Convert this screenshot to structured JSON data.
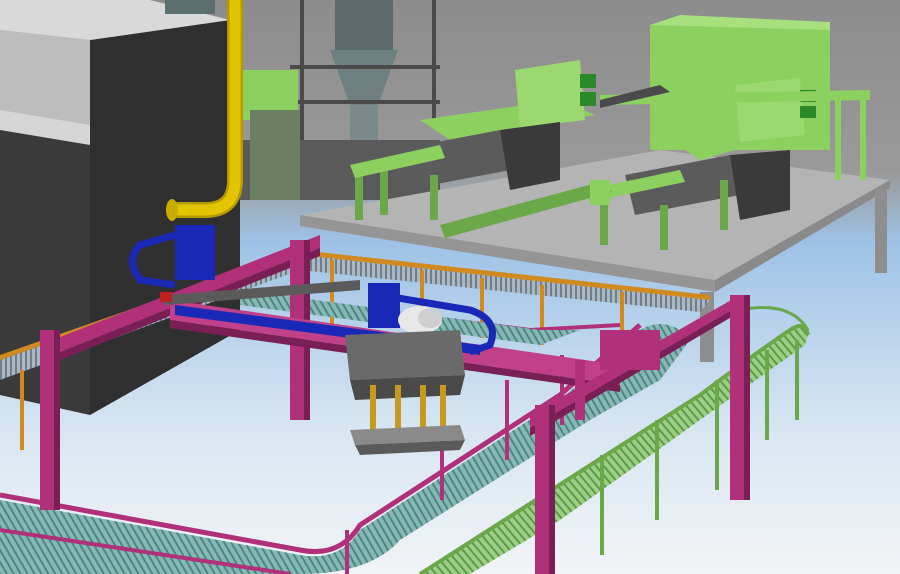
{
  "scene": {
    "colors": {
      "sky_top": "#8c8c8c",
      "sky_blue": "#9ec2e6",
      "floor_light": "#f0f2f4",
      "building_dark": "#2e2e2e",
      "building_light": "#c9c9c9",
      "yellow_pipe": "#e3c400",
      "magenta_frame": "#b0307a",
      "blue_gantry": "#1a28b8",
      "green_machine": "#8cd060",
      "green_dark": "#5a9a3a",
      "platform": "#b4b4b4",
      "platform_side": "#8a8a8a",
      "conveyor_teal": "#6fa6a0",
      "conveyor_green": "#74b85a",
      "orange_rail": "#d08a20",
      "gripper_gray": "#7a7a7a"
    }
  }
}
